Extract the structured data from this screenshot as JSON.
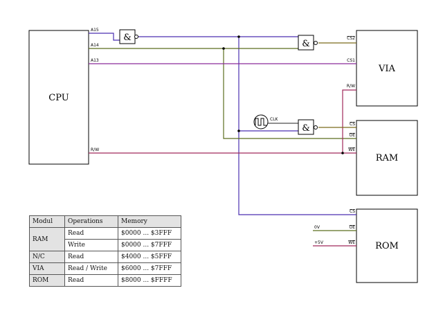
{
  "blocks": {
    "cpu": "CPU",
    "via": "VIA",
    "ram": "RAM",
    "rom": "ROM"
  },
  "gate_symbol": "&",
  "signals": {
    "a15": "A15",
    "a14": "A14",
    "a13": "A13",
    "cpu_rw": "R/W",
    "cs2": "CS2",
    "cs1": "CS1",
    "via_rw": "R/W",
    "clk": "CLK",
    "ram_cs": "CS",
    "ram_oe": "OE",
    "ram_we": "WE",
    "rom_cs": "CS",
    "rom_oe": "OE",
    "rom_we": "WE",
    "zero_v": "0V",
    "plus_5v": "+5V"
  },
  "wire_colors": {
    "a15": "#4a2fb0",
    "a14": "#5a6e1e",
    "a13": "#8a2a9a",
    "rw": "#a0285a",
    "neg": "#7a6a1a"
  },
  "table": {
    "headers": [
      "Modul",
      "Operations",
      "Memory"
    ],
    "ram_label": "RAM",
    "ram_rows": [
      {
        "op": "Read",
        "mem": "$0000 ... $3FFF"
      },
      {
        "op": "Write",
        "mem": "$0000 ... $7FFF"
      }
    ],
    "rows": [
      {
        "mod": "N/C",
        "op": "Read",
        "mem": "$4000 ... $5FFF"
      },
      {
        "mod": "VIA",
        "op": "Read / Write",
        "mem": "$6000 ... $7FFF"
      },
      {
        "mod": "ROM",
        "op": "Read",
        "mem": "$8000 ... $FFFF"
      }
    ]
  }
}
